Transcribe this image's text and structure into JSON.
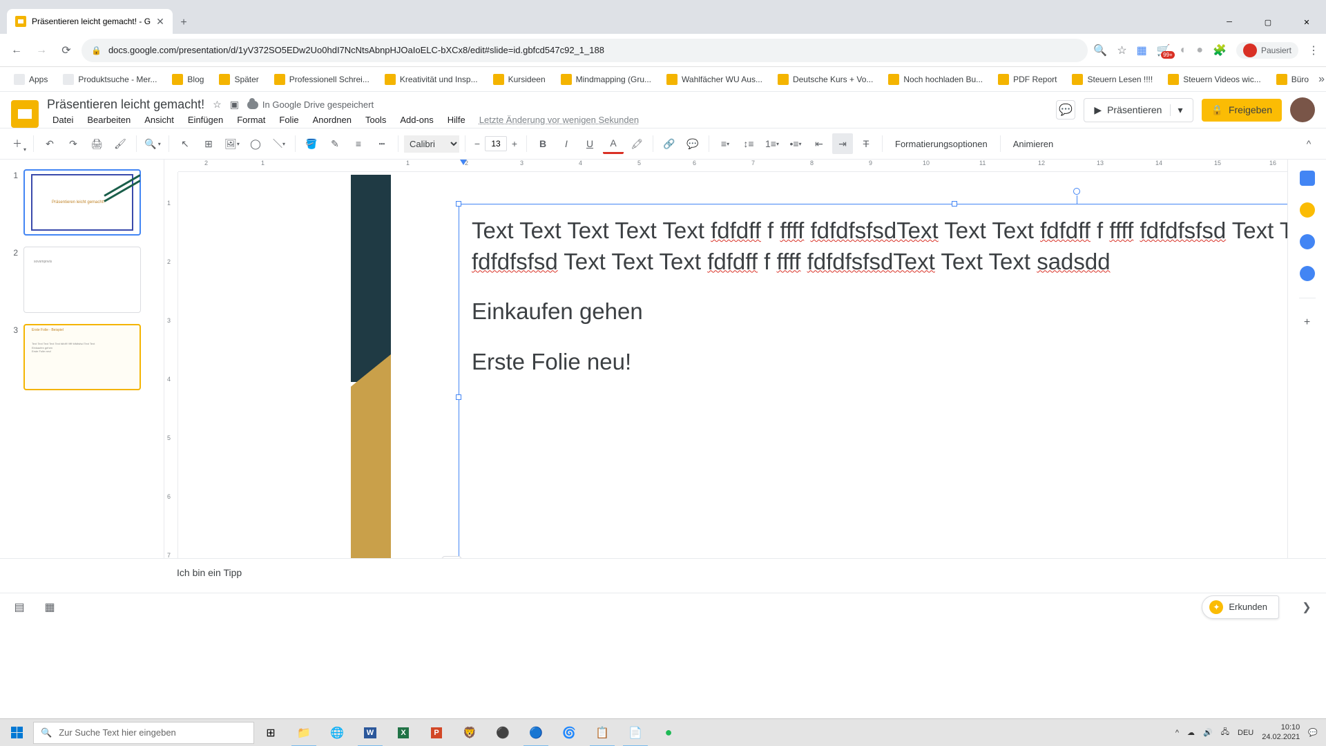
{
  "browser": {
    "tab_title": "Präsentieren leicht gemacht! - G",
    "url": "docs.google.com/presentation/d/1yV372SO5EDw2Uo0hdI7NcNtsAbnpHJOaIoELC-bXCx8/edit#slide=id.gbfcd547c92_1_188",
    "account_status": "Pausiert"
  },
  "bookmarks": [
    "Apps",
    "Produktsuche - Mer...",
    "Blog",
    "Später",
    "Professionell Schrei...",
    "Kreativität und Insp...",
    "Kursideen",
    "Mindmapping  (Gru...",
    "Wahlfächer WU Aus...",
    "Deutsche Kurs + Vo...",
    "Noch hochladen Bu...",
    "PDF Report",
    "Steuern Lesen !!!!",
    "Steuern Videos wic...",
    "Büro"
  ],
  "doc": {
    "title": "Präsentieren leicht gemacht!",
    "save_status": "In Google Drive gespeichert",
    "last_change": "Letzte Änderung vor wenigen Sekunden"
  },
  "menu": [
    "Datei",
    "Bearbeiten",
    "Ansicht",
    "Einfügen",
    "Format",
    "Folie",
    "Anordnen",
    "Tools",
    "Add-ons",
    "Hilfe"
  ],
  "header_buttons": {
    "present": "Präsentieren",
    "share": "Freigeben"
  },
  "toolbar": {
    "font": "Calibri",
    "font_size": "13",
    "format_options": "Formatierungsoptionen",
    "animate": "Animieren"
  },
  "ruler_h": [
    "2",
    "1",
    "",
    "1",
    "2",
    "3",
    "4",
    "5",
    "6",
    "7",
    "8",
    "9",
    "10",
    "11",
    "12",
    "13",
    "14",
    "15",
    "16"
  ],
  "ruler_v": [
    "",
    "1",
    "2",
    "3",
    "4",
    "5",
    "6",
    "7"
  ],
  "slides": {
    "thumbs": [
      {
        "num": "1",
        "title": "Präsentieren leicht gemacht!"
      },
      {
        "num": "2",
        "title": "sovsmpnvis"
      },
      {
        "num": "3",
        "title": "Erste Folie - Beispiel"
      }
    ]
  },
  "slide_text": {
    "p1a": "Text Text Text Text Text ",
    "p1b": "fdfdff",
    "p1c": " f ",
    "p1d": "ffff",
    "p1e": " ",
    "p1f": "fdfdfsfsdText",
    "p1g": " Text Text ",
    "p1h": "fdfdff",
    "p1i": " f ",
    "p1j": "ffff",
    "p1k": " ",
    "p1l": "fdfdfsfsd",
    "p1m": " Text Text Text ",
    "p2a": "ffff",
    "p2b": " ",
    "p2c": "fdfdfsfsd",
    "p2d": " Text Text Text ",
    "p2e": "fdfdff",
    "p2f": " f ",
    "p2g": "ffff",
    "p2h": " ",
    "p2i": "fdfdfsfsdText",
    "p2j": " Text Text ",
    "p2k": "sadsdd",
    "p3": "Einkaufen gehen",
    "p4": "Erste Folie neu!"
  },
  "speaker_notes": "Ich bin ein Tipp",
  "explore": "Erkunden",
  "taskbar": {
    "search_placeholder": "Zur Suche Text hier eingeben",
    "time": "10:10",
    "date": "24.02.2021",
    "lang": "DEU"
  }
}
